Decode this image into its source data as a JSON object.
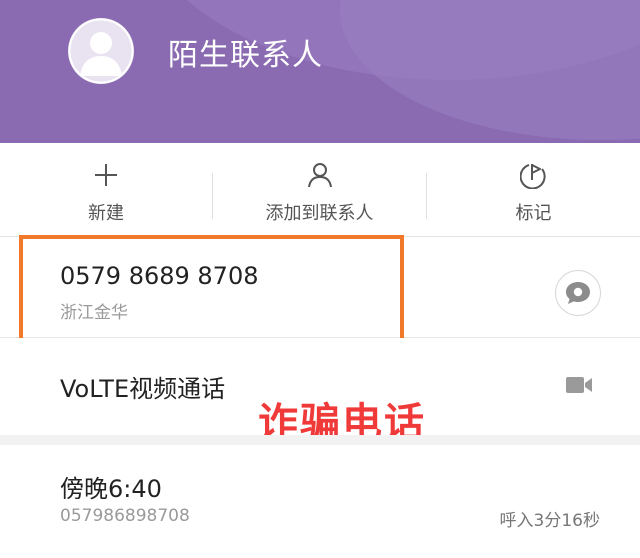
{
  "header": {
    "contact_name": "陌生联系人",
    "avatar_icon": "person-silhouette-icon",
    "background_color": "#8a6bb1"
  },
  "actions": [
    {
      "label": "新建",
      "icon": "plus-icon"
    },
    {
      "label": "添加到联系人",
      "icon": "person-icon"
    },
    {
      "label": "标记",
      "icon": "flag-icon"
    }
  ],
  "number_entry": {
    "number": "0579 8689 8708",
    "location": "浙江金华",
    "message_icon": "message-bubble-icon",
    "highlight_color": "#f07a2a"
  },
  "volte": {
    "label": "VoLTE视频通话",
    "icon": "video-camera-icon"
  },
  "annotation": {
    "text": "诈骗电话",
    "color": "#f03a3a"
  },
  "call_log": {
    "time": "傍晚6:40",
    "number": "057986898708",
    "detail": "呼入3分16秒"
  }
}
